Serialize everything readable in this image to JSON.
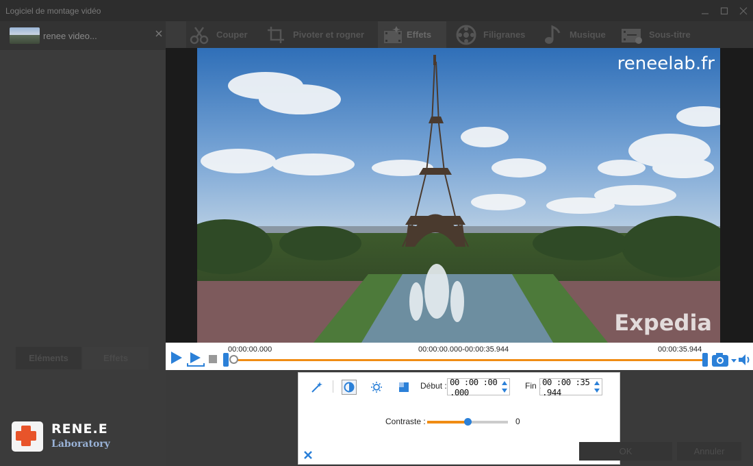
{
  "window": {
    "title": "Logiciel de montage vidéo"
  },
  "media": {
    "name": "renee video..."
  },
  "toolbar": {
    "items": [
      {
        "label": "Couper",
        "icon": "cut-icon"
      },
      {
        "label": "Pivoter et rogner",
        "icon": "rotate-crop-icon"
      },
      {
        "label": "Effets",
        "icon": "effects-icon",
        "active": true
      },
      {
        "label": "Filigranes",
        "icon": "watermark-icon"
      },
      {
        "label": "Musique",
        "icon": "music-icon"
      },
      {
        "label": "Sous-titre",
        "icon": "subtitle-icon"
      }
    ]
  },
  "video": {
    "watermark_top": "reneelab.fr",
    "watermark_bottom": "Expedia"
  },
  "playback": {
    "time_start": "00:00:00.000",
    "time_range": "00:00:00.000-00:00:35.944",
    "time_end": "00:00:35.944",
    "position_fraction": 0.0
  },
  "sidebar": {
    "tabs": [
      {
        "label": "Eléments"
      },
      {
        "label": "Effets"
      }
    ]
  },
  "brand": {
    "line1": "RENE.E",
    "line2": "Laboratory"
  },
  "effects_dialog": {
    "debut_label": "Début :",
    "debut_value": "00 :00 :00 .000",
    "fin_label": "Fin :",
    "fin_value": "00 :00 :35 .944",
    "contrast_label": "Contraste :",
    "contrast_value": "0",
    "contrast_fraction": 0.5
  },
  "buttons": {
    "ok": "OK",
    "cancel": "Annuler"
  },
  "colors": {
    "accent_blue": "#2b80d8",
    "accent_orange": "#f08c14"
  }
}
